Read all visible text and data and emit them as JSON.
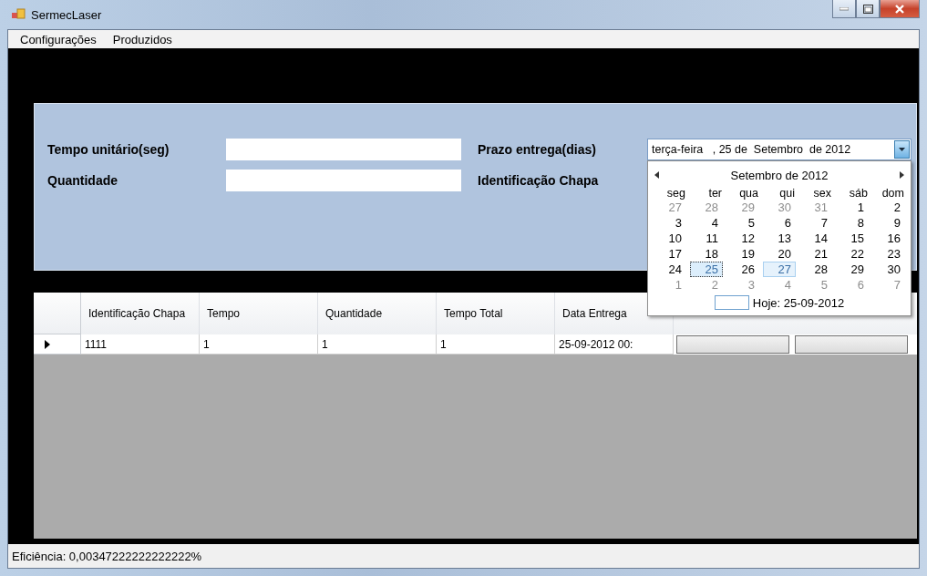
{
  "window": {
    "title": "SermecLaser"
  },
  "menu": [
    {
      "label": "Configurações"
    },
    {
      "label": "Produzidos"
    }
  ],
  "form": {
    "fields": [
      {
        "label": "Tempo unitário(seg)"
      },
      {
        "label": "Quantidade"
      }
    ],
    "right_labels": [
      "Prazo entrega(dias)",
      "Identificação Chapa"
    ],
    "date_picker": {
      "value": "terça-feira   , 25 de  Setembro  de 2012",
      "expanded": true
    }
  },
  "calendar": {
    "month": "Setembro de 2012",
    "weekdays": [
      "seg",
      "ter",
      "qua",
      "qui",
      "sex",
      "sáb",
      "dom"
    ],
    "weeks": [
      [
        {
          "text": "27",
          "other": true,
          "selected": false,
          "highlighted": false
        },
        {
          "text": "28",
          "other": true,
          "selected": false,
          "highlighted": false
        },
        {
          "text": "29",
          "other": true,
          "selected": false,
          "highlighted": false
        },
        {
          "text": "30",
          "other": true,
          "selected": false,
          "highlighted": false
        },
        {
          "text": "31",
          "other": true,
          "selected": false,
          "highlighted": false
        },
        {
          "text": "1",
          "other": false,
          "selected": false,
          "highlighted": false
        },
        {
          "text": "2",
          "other": false,
          "selected": false,
          "highlighted": false
        }
      ],
      [
        {
          "text": "3",
          "other": false,
          "selected": false,
          "highlighted": false
        },
        {
          "text": "4",
          "other": false,
          "selected": false,
          "highlighted": false
        },
        {
          "text": "5",
          "other": false,
          "selected": false,
          "highlighted": false
        },
        {
          "text": "6",
          "other": false,
          "selected": false,
          "highlighted": false
        },
        {
          "text": "7",
          "other": false,
          "selected": false,
          "highlighted": false
        },
        {
          "text": "8",
          "other": false,
          "selected": false,
          "highlighted": false
        },
        {
          "text": "9",
          "other": false,
          "selected": false,
          "highlighted": false
        }
      ],
      [
        {
          "text": "10",
          "other": false,
          "selected": false,
          "highlighted": false
        },
        {
          "text": "11",
          "other": false,
          "selected": false,
          "highlighted": false
        },
        {
          "text": "12",
          "other": false,
          "selected": false,
          "highlighted": false
        },
        {
          "text": "13",
          "other": false,
          "selected": false,
          "highlighted": false
        },
        {
          "text": "14",
          "other": false,
          "selected": false,
          "highlighted": false
        },
        {
          "text": "15",
          "other": false,
          "selected": false,
          "highlighted": false
        },
        {
          "text": "16",
          "other": false,
          "selected": false,
          "highlighted": false
        }
      ],
      [
        {
          "text": "17",
          "other": false,
          "selected": false,
          "highlighted": false
        },
        {
          "text": "18",
          "other": false,
          "selected": false,
          "highlighted": false
        },
        {
          "text": "19",
          "other": false,
          "selected": false,
          "highlighted": false
        },
        {
          "text": "20",
          "other": false,
          "selected": false,
          "highlighted": false
        },
        {
          "text": "21",
          "other": false,
          "selected": false,
          "highlighted": false
        },
        {
          "text": "22",
          "other": false,
          "selected": false,
          "highlighted": false
        },
        {
          "text": "23",
          "other": false,
          "selected": false,
          "highlighted": false
        }
      ],
      [
        {
          "text": "24",
          "other": false,
          "selected": false,
          "highlighted": false
        },
        {
          "text": "25",
          "other": false,
          "selected": true,
          "highlighted": false
        },
        {
          "text": "26",
          "other": false,
          "selected": false,
          "highlighted": false
        },
        {
          "text": "27",
          "other": false,
          "selected": false,
          "highlighted": true
        },
        {
          "text": "28",
          "other": false,
          "selected": false,
          "highlighted": false
        },
        {
          "text": "29",
          "other": false,
          "selected": false,
          "highlighted": false
        },
        {
          "text": "30",
          "other": false,
          "selected": false,
          "highlighted": false
        }
      ],
      [
        {
          "text": "1",
          "other": true,
          "selected": false,
          "highlighted": false
        },
        {
          "text": "2",
          "other": true,
          "selected": false,
          "highlighted": false
        },
        {
          "text": "3",
          "other": true,
          "selected": false,
          "highlighted": false
        },
        {
          "text": "4",
          "other": true,
          "selected": false,
          "highlighted": false
        },
        {
          "text": "5",
          "other": true,
          "selected": false,
          "highlighted": false
        },
        {
          "text": "6",
          "other": true,
          "selected": false,
          "highlighted": false
        },
        {
          "text": "7",
          "other": true,
          "selected": false,
          "highlighted": false
        }
      ]
    ],
    "today": "Hoje: 25-09-2012"
  },
  "table": {
    "columns": [
      "Identificação Chapa",
      "Tempo",
      "Quantidade",
      "Tempo Total",
      "Data Entrega"
    ],
    "rows": [
      {
        "selected": true,
        "cells": [
          "1111",
          "1",
          "1",
          "1",
          "25-09-2012 00:"
        ]
      }
    ]
  },
  "status_bar": "Eficiência: 0,00347222222222222%"
}
